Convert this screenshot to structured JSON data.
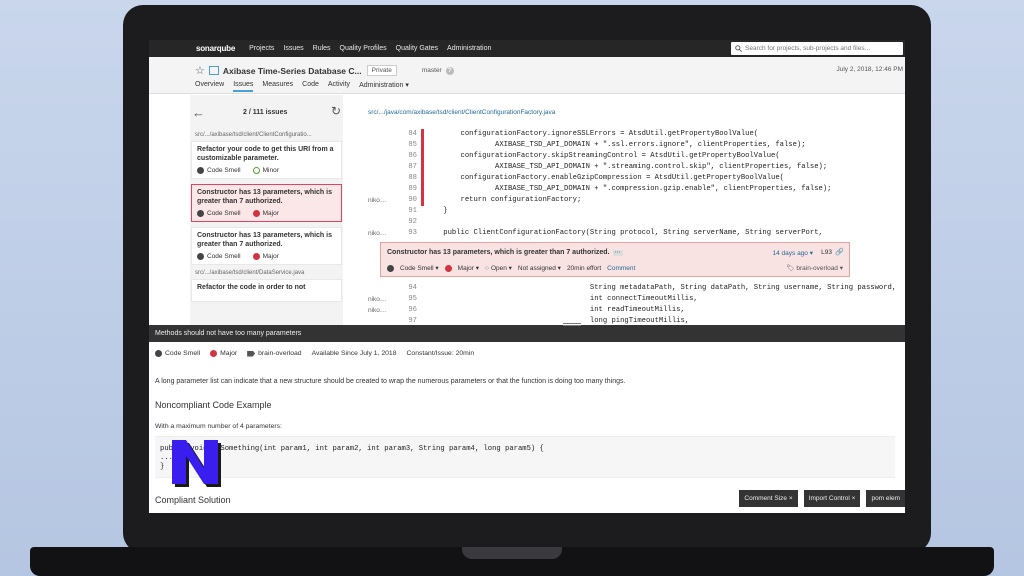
{
  "topnav": {
    "logo": "sonarqube",
    "items": [
      "Projects",
      "Issues",
      "Rules",
      "Quality Profiles",
      "Quality Gates",
      "Administration"
    ],
    "search_placeholder": "Search for projects, sub-projects and files..."
  },
  "project": {
    "name": "Axibase Time-Series Database C...",
    "visibility": "Private",
    "branch": "master",
    "date": "July 2, 2018, 12:46 PM",
    "tabs": [
      "Overview",
      "Issues",
      "Measures",
      "Code",
      "Activity",
      "Administration"
    ],
    "active_tab": "Issues"
  },
  "issues_panel": {
    "count": "2 / 111 issues",
    "file1": "src/.../axibase/tsd/client/ClientConfiguratio...",
    "file2": "src/.../axibase/tsd/client/DataService.java",
    "issues": [
      {
        "message": "Refactor your code to get this URI from a customizable parameter.",
        "type": "Code Smell",
        "severity": "Minor"
      },
      {
        "message": "Constructor has 13 parameters, which is greater than 7 authorized.",
        "type": "Code Smell",
        "severity": "Major"
      },
      {
        "message": "Constructor has 13 parameters, which is greater than 7 authorized.",
        "type": "Code Smell",
        "severity": "Major"
      },
      {
        "message": "Refactor the code in order to not"
      }
    ]
  },
  "code": {
    "path": "src/.../java/com/axibase/tsd/client/ClientConfigurationFactory.java",
    "lines_top": [
      {
        "num": "84",
        "author": "",
        "text": "        configurationFactory.ignoreSSLErrors = AtsdUtil.getPropertyBoolValue("
      },
      {
        "num": "85",
        "author": "",
        "text": "                AXIBASE_TSD_API_DOMAIN + \".ssl.errors.ignore\", clientProperties, false);"
      },
      {
        "num": "86",
        "author": "",
        "text": "        configurationFactory.skipStreamingControl = AtsdUtil.getPropertyBoolValue("
      },
      {
        "num": "87",
        "author": "",
        "text": "                AXIBASE_TSD_API_DOMAIN + \".streaming.control.skip\", clientProperties, false);"
      },
      {
        "num": "88",
        "author": "",
        "text": "        configurationFactory.enableGzipCompression = AtsdUtil.getPropertyBoolValue("
      },
      {
        "num": "89",
        "author": "",
        "text": "                AXIBASE_TSD_API_DOMAIN + \".compression.gzip.enable\", clientProperties, false);"
      },
      {
        "num": "90",
        "author": "niko…",
        "text": "        return configurationFactory;"
      },
      {
        "num": "91",
        "author": "",
        "text": "    }"
      },
      {
        "num": "92",
        "author": "",
        "text": ""
      },
      {
        "num": "93",
        "author": "niko…",
        "text": "    public ClientConfigurationFactory(String protocol, String serverName, String serverPort,"
      }
    ],
    "lines_bottom": [
      {
        "num": "94",
        "author": "",
        "text": "                                      String metadataPath, String dataPath, String username, String password,"
      },
      {
        "num": "95",
        "author": "niko…",
        "text": "                                      int connectTimeoutMillis,"
      },
      {
        "num": "96",
        "author": "niko…",
        "text": "                                      int readTimeoutMillis,"
      },
      {
        "num": "97",
        "author": "",
        "text": "                                      long pingTimeoutMillis,"
      }
    ]
  },
  "issue_box": {
    "message": "Constructor has 13 parameters, which is greater than 7 authorized.",
    "dots": "···",
    "age": "14 days ago ▾",
    "line": "L93",
    "type": "Code Smell ▾",
    "severity": "Major ▾",
    "status": "Open ▾",
    "assignee": "Not assigned ▾",
    "effort": "20min effort",
    "comment": "Comment",
    "tag": "brain-overload ▾"
  },
  "rule": {
    "title": "Methods should not have too many parameters",
    "type": "Code Smell",
    "severity": "Major",
    "tag": "brain-overload",
    "since": "Available Since July 1, 2018",
    "constant": "Constant/Issue: 20min",
    "description": "A long parameter list can indicate that a new structure should be created to wrap the numerous parameters or that the function is doing too many things.",
    "noncompliant_heading": "Noncompliant Code Example",
    "max_params": "With a maximum number of 4 parameters:",
    "code_sample": "public void doSomething(int param1, int param2, int param3, String param4, long param5) {\n...\n}",
    "compliant_heading": "Compliant Solution"
  },
  "chips": [
    "Comment Size ×",
    "Import Control ×",
    "pom elem"
  ],
  "colors": {
    "accent": "#4b9fd5",
    "major": "#d4333f",
    "minor": "#5a9e36",
    "nav": "#262626"
  }
}
